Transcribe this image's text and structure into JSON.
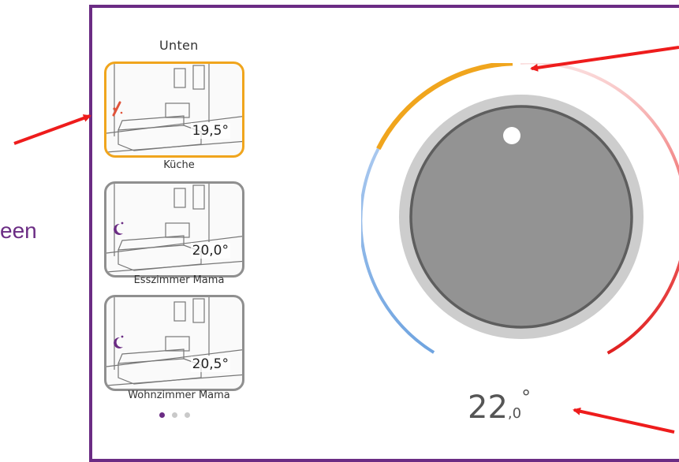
{
  "outside_text": "een",
  "floor": {
    "title": "Unten"
  },
  "rooms": [
    {
      "name": "Küche",
      "temp": "19,5°",
      "icon": "heating-radiator-icon",
      "active": true
    },
    {
      "name": "Esszimmer Mama",
      "temp": "20,0°",
      "icon": "night-mode-moon-icon",
      "active": false
    },
    {
      "name": "Wohnzimmer Mama",
      "temp": "20,5°",
      "icon": "night-mode-moon-icon",
      "active": false
    }
  ],
  "pager": {
    "pages": 3,
    "current": 1
  },
  "dial": {
    "setpoint_int": "22",
    "setpoint_dec": ",0",
    "unit": "°"
  },
  "colors": {
    "frame": "#6b2c84",
    "active": "#f0a51d",
    "cold": "#6fa4e0",
    "hot": "#e53935",
    "annotation": "#ee1c1c"
  }
}
